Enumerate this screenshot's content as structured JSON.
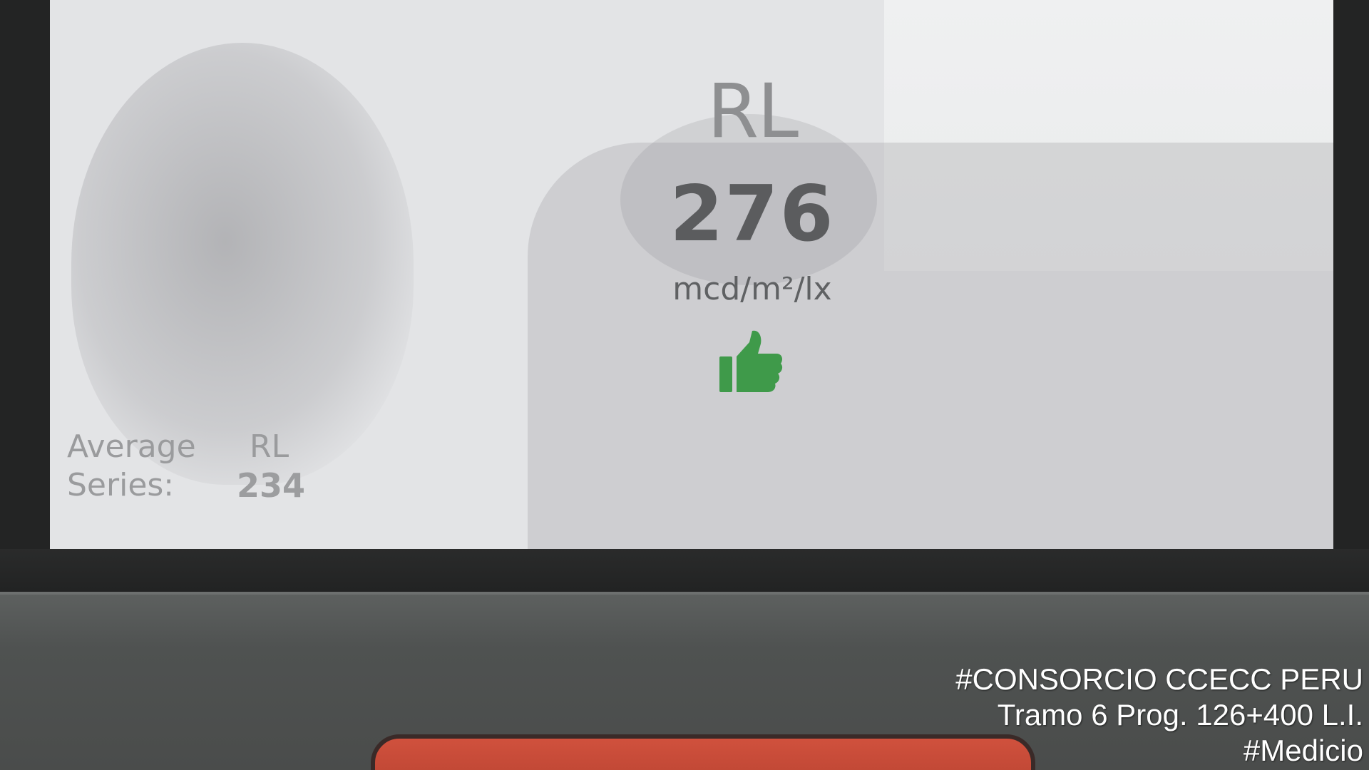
{
  "display": {
    "measure_label": "RL",
    "measure_value": "276",
    "unit": "mcd/m²/lx",
    "result_icon": "thumbs-up-icon",
    "result_color": "#3f9a4a",
    "average_line1_left": "Average",
    "average_line1_right": "RL",
    "average_line2_left": "Series:",
    "average_value": "234"
  },
  "watermark": {
    "line1": "#CONSORCIO CCECC PERU",
    "line2": "Tramo 6 Prog. 126+400 L.I.",
    "line3": "#Medicio"
  }
}
